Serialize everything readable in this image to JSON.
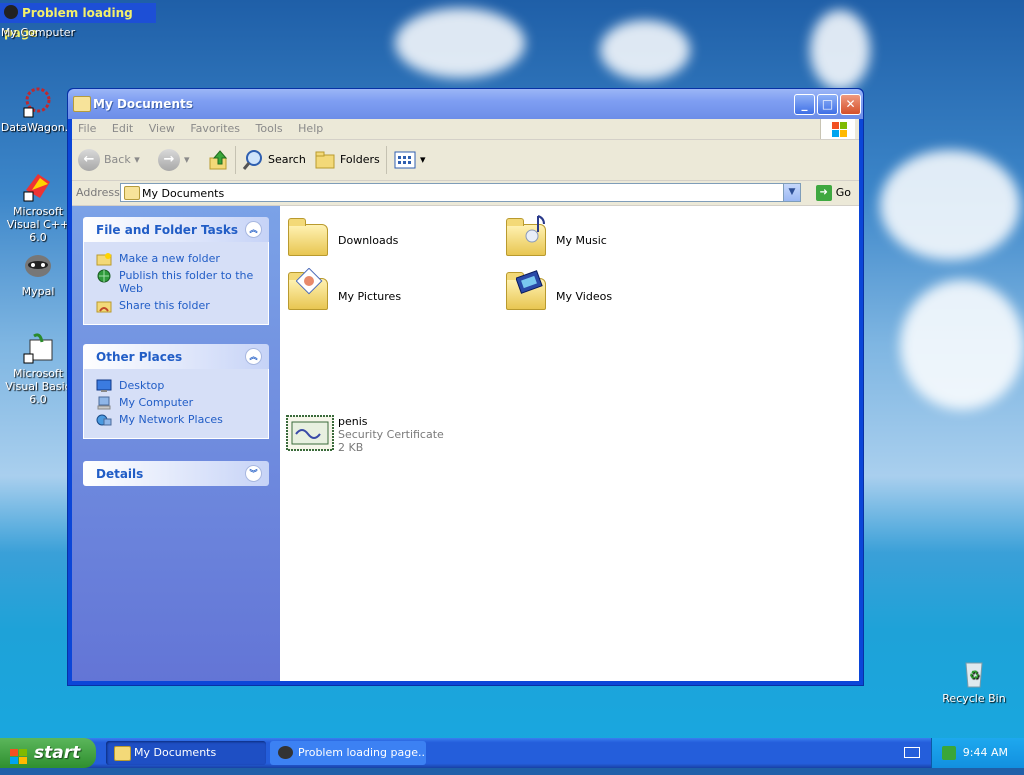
{
  "banner": {
    "text": "Problem loading page"
  },
  "desktop_icons": [
    {
      "label": "My Computer"
    },
    {
      "label": "DataWagon..."
    },
    {
      "label": "Microsoft Visual C++ 6.0"
    },
    {
      "label": "Mypal"
    },
    {
      "label": "Microsoft Visual Basic 6.0"
    },
    {
      "label": "Recycle Bin"
    }
  ],
  "window": {
    "title": "My Documents",
    "menu": [
      "File",
      "Edit",
      "View",
      "Favorites",
      "Tools",
      "Help"
    ],
    "toolbar": {
      "back": "Back",
      "search": "Search",
      "folders": "Folders"
    },
    "address": {
      "label": "Address",
      "value": "My Documents",
      "go": "Go"
    }
  },
  "leftpane": {
    "file_tasks": {
      "title": "File and Folder Tasks",
      "items": [
        "Make a new folder",
        "Publish this folder to the Web",
        "Share this folder"
      ]
    },
    "other_places": {
      "title": "Other Places",
      "items": [
        "Desktop",
        "My Computer",
        "My Network Places"
      ]
    },
    "details": {
      "title": "Details"
    }
  },
  "content": {
    "items": [
      {
        "name": "Downloads"
      },
      {
        "name": "My Music"
      },
      {
        "name": "My Pictures"
      },
      {
        "name": "My Videos"
      },
      {
        "name": "penis",
        "type": "Security Certificate",
        "size": "2 KB"
      }
    ]
  },
  "taskbar": {
    "start": "start",
    "items": [
      "My Documents",
      "Problem loading page..."
    ],
    "clock": "9:44 AM"
  },
  "colors": {
    "xp_blue": "#0b46d8",
    "task_link": "#215dc6",
    "start_green": "#2f8f2f"
  }
}
